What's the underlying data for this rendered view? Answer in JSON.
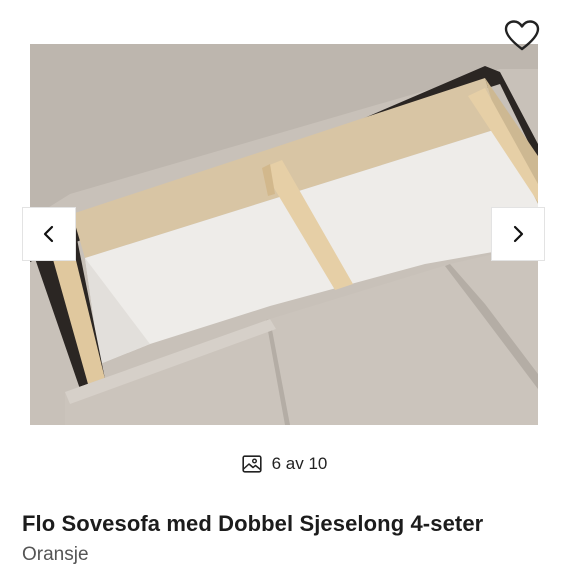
{
  "gallery": {
    "counter": "6 av 10",
    "image_alt": "Flo Sovesofa med Dobbel Sjeselong 4-seter – oppbevaringsrom",
    "icons": {
      "favorite": "heart-outline-icon",
      "previous": "chevron-left-icon",
      "next": "chevron-right-icon",
      "counter": "image-icon"
    }
  },
  "product": {
    "title": "Flo Sovesofa med Dobbel Sjeselong 4-seter",
    "color": "Oransje"
  }
}
